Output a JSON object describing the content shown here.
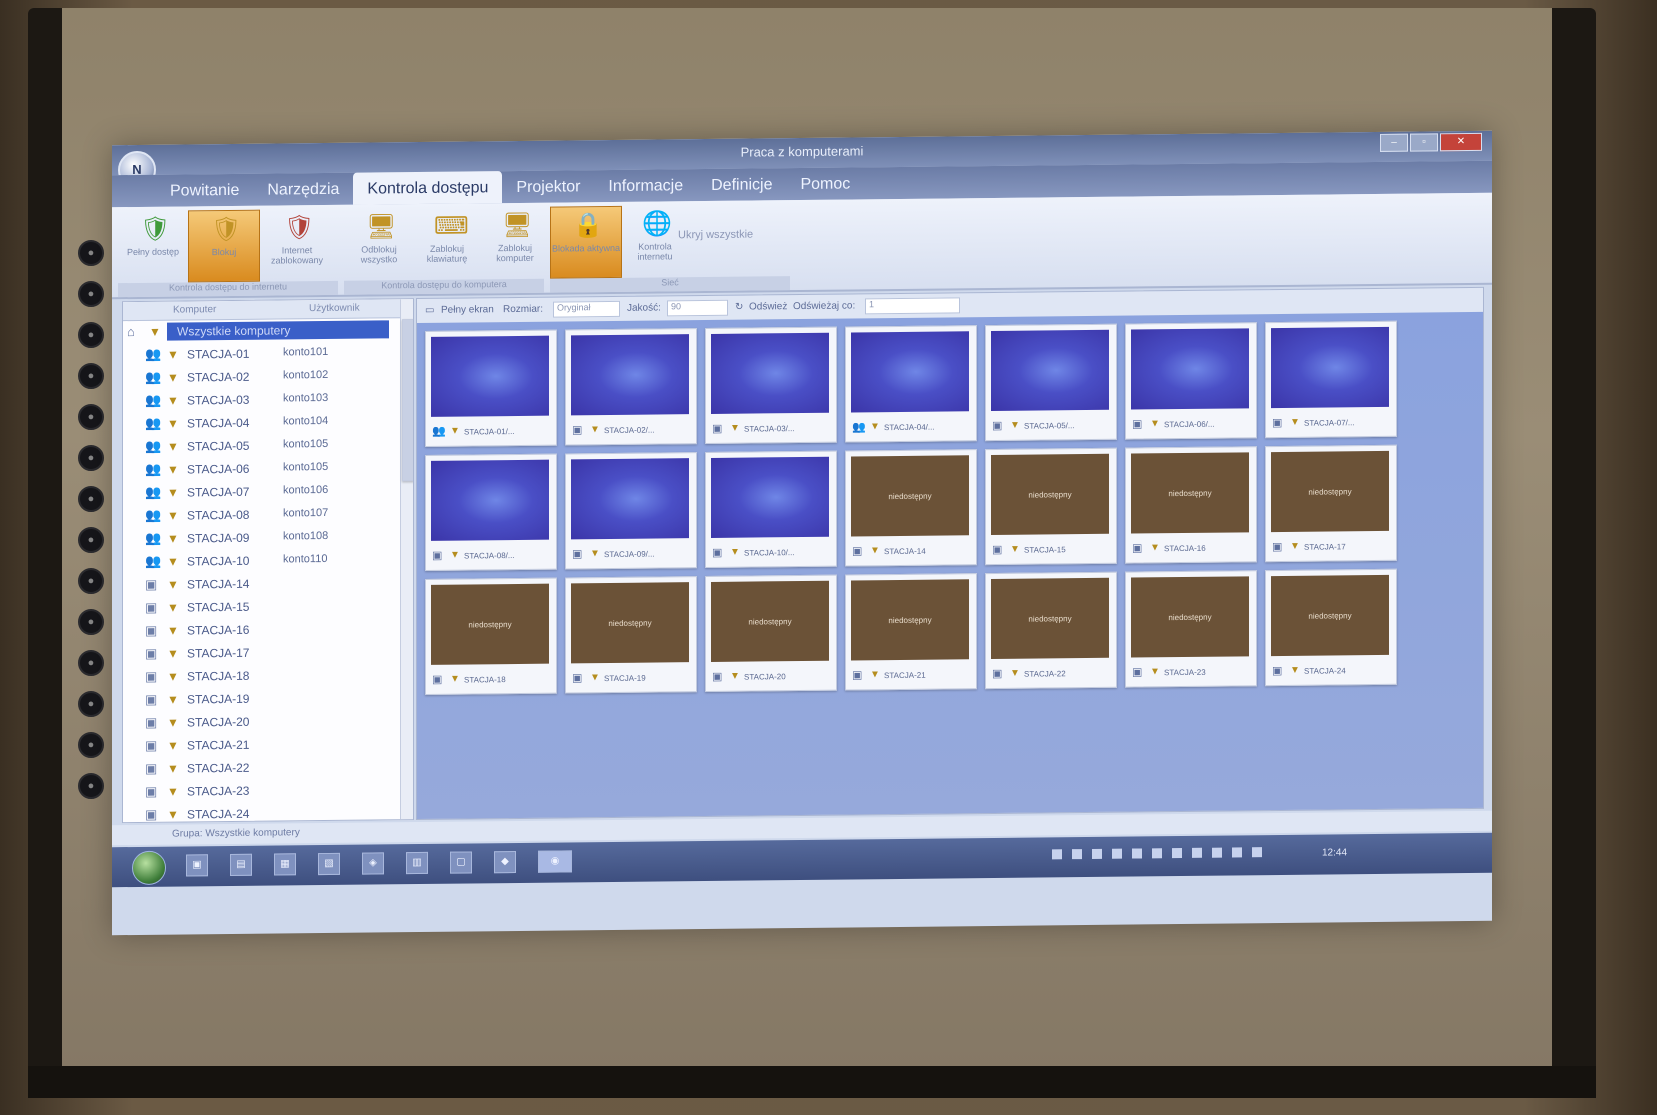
{
  "window": {
    "title": "Praca z komputerami",
    "app_logo": "N",
    "controls": [
      "–",
      "▫",
      "✕"
    ]
  },
  "tabs": [
    "Powitanie",
    "Narzędzia",
    "Kontrola dostępu",
    "Projektor",
    "Informacje",
    "Definicje",
    "Pomoc"
  ],
  "ribbon": {
    "buttons": [
      {
        "label": "Pełny dostęp",
        "icon": "shield-green-icon",
        "glyph": "🛡",
        "active": false
      },
      {
        "label": "Blokuj",
        "icon": "shield-yellow-icon",
        "glyph": "🛡",
        "active": true
      },
      {
        "label": "Internet zablokowany",
        "icon": "shield-red-icon",
        "glyph": "🛡",
        "active": false
      },
      {
        "label": "Odblokuj wszystko",
        "icon": "unlock-computers-icon",
        "glyph": "🖥",
        "active": false
      },
      {
        "label": "Zablokuj klawiaturę",
        "icon": "lock-keyboard-icon",
        "glyph": "⌨",
        "active": false
      },
      {
        "label": "Zablokuj komputer",
        "icon": "lock-computer-icon",
        "glyph": "🖥",
        "active": false
      },
      {
        "label": "Blokada aktywna",
        "icon": "lock-active-icon",
        "glyph": "🔒",
        "active": true
      },
      {
        "label": "Kontrola internetu",
        "icon": "internet-control-icon",
        "glyph": "🌐",
        "active": false
      }
    ],
    "extra_link": "Ukryj wszystkie",
    "groups": [
      "Kontrola dostępu do internetu",
      "Kontrola dostępu do komputera",
      "Sieć"
    ]
  },
  "tree": {
    "col_computer": "Komputer",
    "col_user": "Użytkownik",
    "root": "Wszystkie komputery",
    "rows": [
      {
        "name": "STACJA-01",
        "user": "konto101",
        "logged": true
      },
      {
        "name": "STACJA-02",
        "user": "konto102",
        "logged": true
      },
      {
        "name": "STACJA-03",
        "user": "konto103",
        "logged": true
      },
      {
        "name": "STACJA-04",
        "user": "konto104",
        "logged": true
      },
      {
        "name": "STACJA-05",
        "user": "konto105",
        "logged": true
      },
      {
        "name": "STACJA-06",
        "user": "konto105",
        "logged": true
      },
      {
        "name": "STACJA-07",
        "user": "konto106",
        "logged": true
      },
      {
        "name": "STACJA-08",
        "user": "konto107",
        "logged": true
      },
      {
        "name": "STACJA-09",
        "user": "konto108",
        "logged": true
      },
      {
        "name": "STACJA-10",
        "user": "konto110",
        "logged": true
      },
      {
        "name": "STACJA-14",
        "user": "",
        "logged": false
      },
      {
        "name": "STACJA-15",
        "user": "",
        "logged": false
      },
      {
        "name": "STACJA-16",
        "user": "",
        "logged": false
      },
      {
        "name": "STACJA-17",
        "user": "",
        "logged": false
      },
      {
        "name": "STACJA-18",
        "user": "",
        "logged": false
      },
      {
        "name": "STACJA-19",
        "user": "",
        "logged": false
      },
      {
        "name": "STACJA-20",
        "user": "",
        "logged": false
      },
      {
        "name": "STACJA-21",
        "user": "",
        "logged": false
      },
      {
        "name": "STACJA-22",
        "user": "",
        "logged": false
      },
      {
        "name": "STACJA-23",
        "user": "",
        "logged": false
      },
      {
        "name": "STACJA-24",
        "user": "",
        "logged": false
      }
    ]
  },
  "toolbar": {
    "view_label": "Pełny ekran",
    "size_label": "Rozmiar:",
    "size_value": "Oryginał",
    "quality_label": "Jakość:",
    "quality_value": "90",
    "refresh_label": "Odśwież",
    "refresh_every_label": "Odświeżaj co:",
    "refresh_every_value": "1"
  },
  "offline_message": "niedostępny",
  "thumbnails": [
    {
      "name": "STACJA-01/...",
      "state": "on",
      "user": true
    },
    {
      "name": "STACJA-02/...",
      "state": "on",
      "user": false
    },
    {
      "name": "STACJA-03/...",
      "state": "on",
      "user": false
    },
    {
      "name": "STACJA-04/...",
      "state": "on",
      "user": true
    },
    {
      "name": "STACJA-05/...",
      "state": "on",
      "user": false
    },
    {
      "name": "STACJA-06/...",
      "state": "on",
      "user": false
    },
    {
      "name": "STACJA-07/...",
      "state": "on",
      "user": false
    },
    {
      "name": "STACJA-08/...",
      "state": "on",
      "user": false
    },
    {
      "name": "STACJA-09/...",
      "state": "on",
      "user": false
    },
    {
      "name": "STACJA-10/...",
      "state": "on",
      "user": false
    },
    {
      "name": "STACJA-14",
      "state": "off",
      "user": false
    },
    {
      "name": "STACJA-15",
      "state": "off",
      "user": false
    },
    {
      "name": "STACJA-16",
      "state": "off",
      "user": false
    },
    {
      "name": "STACJA-17",
      "state": "off",
      "user": false
    },
    {
      "name": "STACJA-18",
      "state": "off",
      "user": false
    },
    {
      "name": "STACJA-19",
      "state": "off",
      "user": false
    },
    {
      "name": "STACJA-20",
      "state": "off",
      "user": false
    },
    {
      "name": "STACJA-21",
      "state": "off",
      "user": false
    },
    {
      "name": "STACJA-22",
      "state": "off",
      "user": false
    },
    {
      "name": "STACJA-23",
      "state": "off",
      "user": false
    },
    {
      "name": "STACJA-24",
      "state": "off",
      "user": false
    }
  ],
  "status": "Grupa: Wszystkie komputery",
  "taskbar": {
    "apps": [
      "▣",
      "▤",
      "▦",
      "▧",
      "◈",
      "▥",
      "▢",
      "◆",
      "◉"
    ],
    "clock": "12:44"
  },
  "board_buttons": {
    "left": [
      "●",
      "●",
      "●",
      "●",
      "●",
      "●",
      "●",
      "●",
      "●",
      "●",
      "●",
      "●",
      "●",
      "●"
    ],
    "right": [
      "●",
      "●",
      "●",
      "●",
      "●",
      "●",
      "●",
      "●",
      "●",
      "●",
      "●",
      "●",
      "●",
      "●"
    ]
  }
}
